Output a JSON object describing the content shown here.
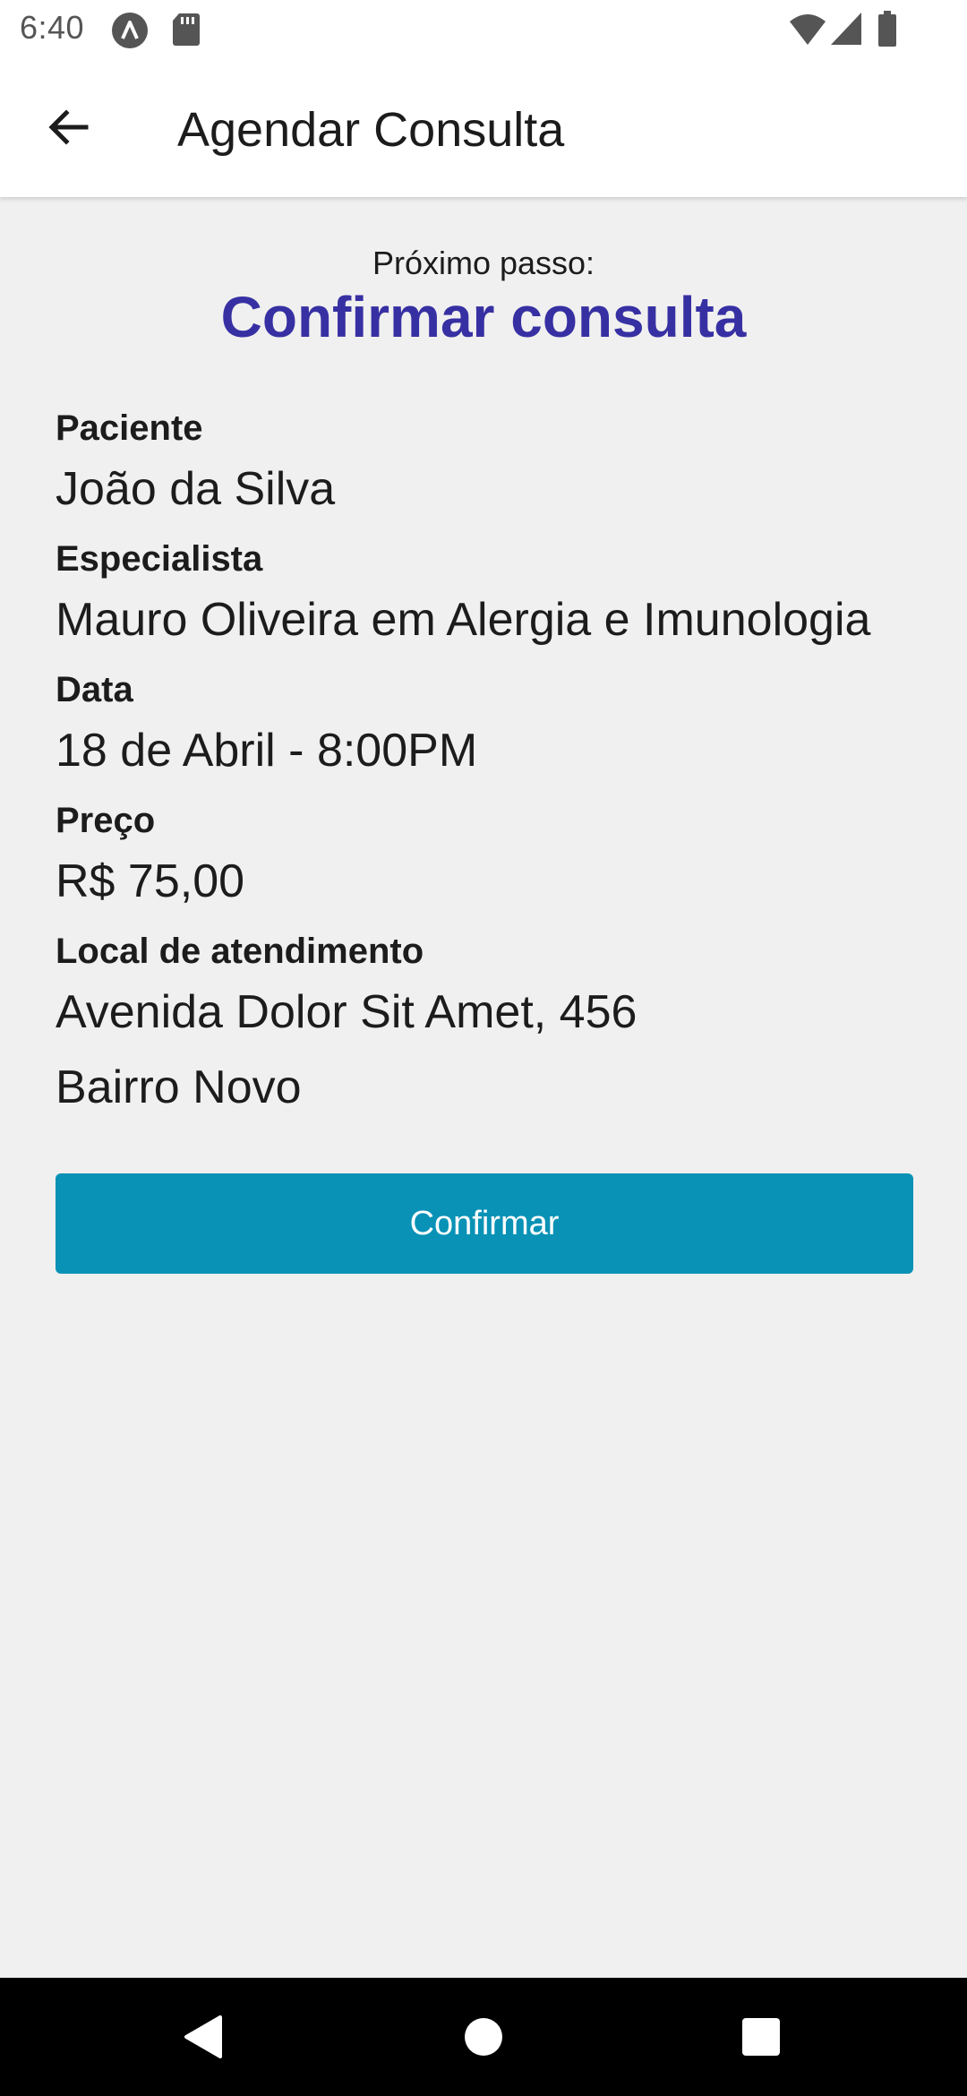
{
  "status_bar": {
    "time": "6:40",
    "icons": [
      "app-notification-icon",
      "sd-card-icon",
      "wifi-icon",
      "signal-icon",
      "battery-icon"
    ]
  },
  "app_bar": {
    "back_icon": "arrow-left-icon",
    "title": "Agendar Consulta"
  },
  "step": {
    "subtitle": "Próximo passo:",
    "title": "Confirmar consulta"
  },
  "details": {
    "patient_label": "Paciente",
    "patient_value": "João da Silva",
    "specialist_label": "Especialista",
    "specialist_value": "Mauro Oliveira em Alergia e Imunologia",
    "date_label": "Data",
    "date_value": "18 de Abril - 8:00PM",
    "price_label": "Preço",
    "price_value": "R$ 75,00",
    "location_label": "Local de atendimento",
    "location_line1": "Avenida Dolor Sit Amet, 456",
    "location_line2": "Bairro Novo"
  },
  "actions": {
    "confirm_label": "Confirmar"
  },
  "nav_bar": {
    "icons": [
      "nav-back-icon",
      "nav-home-icon",
      "nav-recents-icon"
    ]
  },
  "colors": {
    "accent_title": "#3730a3",
    "button_bg": "#0992b6",
    "background": "#f0f0f0"
  }
}
